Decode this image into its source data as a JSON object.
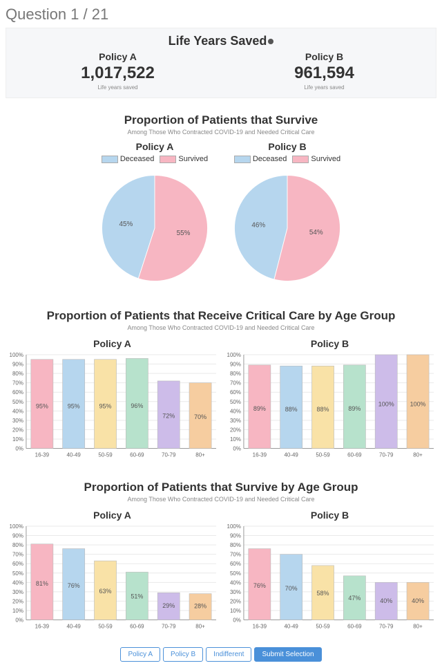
{
  "question_counter": "Question 1 / 21",
  "palette": [
    "#f7b6c2",
    "#b6d6ee",
    "#f9e2a7",
    "#b7e2cc",
    "#cdbce9",
    "#f6cda0"
  ],
  "metrics_panel": {
    "title": "Life Years Saved",
    "policy_a_label": "Policy A",
    "policy_b_label": "Policy B",
    "policy_a_value": "1,017,522",
    "policy_b_value": "961,594",
    "sub": "Life years saved"
  },
  "survival_section": {
    "title": "Proportion of Patients that Survive",
    "sub": "Among Those Who Contracted COVID-19 and Needed Critical Care",
    "policy_a_label": "Policy A",
    "policy_b_label": "Policy B",
    "legend": {
      "deceased": "Deceased",
      "survived": "Survived"
    },
    "policy_a": {
      "deceased_pct": 45,
      "survived_pct": 55
    },
    "policy_b": {
      "deceased_pct": 46,
      "survived_pct": 54
    }
  },
  "critical_care_section": {
    "title": "Proportion of Patients that Receive Critical Care by Age Group",
    "sub": "Among Those Who Contracted COVID-19 and Needed Critical Care",
    "policy_a_label": "Policy A",
    "policy_b_label": "Policy B",
    "categories": [
      "16-39",
      "40-49",
      "50-59",
      "60-69",
      "70-79",
      "80+"
    ],
    "policy_a_values": [
      95,
      95,
      95,
      96,
      72,
      70
    ],
    "policy_b_values": [
      89,
      88,
      88,
      89,
      100,
      100
    ]
  },
  "survive_by_age_section": {
    "title": "Proportion of Patients that Survive by Age Group",
    "sub": "Among Those Who Contracted COVID-19 and Needed Critical Care",
    "policy_a_label": "Policy A",
    "policy_b_label": "Policy B",
    "categories": [
      "16-39",
      "40-49",
      "50-59",
      "60-69",
      "70-79",
      "80+"
    ],
    "policy_a_values": [
      81,
      76,
      63,
      51,
      29,
      28
    ],
    "policy_b_values": [
      76,
      70,
      58,
      47,
      40,
      40
    ]
  },
  "actions": {
    "policy_a": "Policy A",
    "policy_b": "Policy B",
    "indifferent": "Indifferent",
    "submit": "Submit Selection"
  },
  "chart_data": [
    {
      "type": "pie",
      "title": "Proportion of Patients that Survive — Policy A",
      "series": [
        {
          "name": "Deceased",
          "value": 45
        },
        {
          "name": "Survived",
          "value": 55
        }
      ]
    },
    {
      "type": "pie",
      "title": "Proportion of Patients that Survive — Policy B",
      "series": [
        {
          "name": "Deceased",
          "value": 46
        },
        {
          "name": "Survived",
          "value": 54
        }
      ]
    },
    {
      "type": "bar",
      "title": "Proportion of Patients that Receive Critical Care by Age Group — Policy A",
      "categories": [
        "16-39",
        "40-49",
        "50-59",
        "60-69",
        "70-79",
        "80+"
      ],
      "values": [
        95,
        95,
        95,
        96,
        72,
        70
      ],
      "ylim": [
        0,
        100
      ],
      "ylabel": "%"
    },
    {
      "type": "bar",
      "title": "Proportion of Patients that Receive Critical Care by Age Group — Policy B",
      "categories": [
        "16-39",
        "40-49",
        "50-59",
        "60-69",
        "70-79",
        "80+"
      ],
      "values": [
        89,
        88,
        88,
        89,
        100,
        100
      ],
      "ylim": [
        0,
        100
      ],
      "ylabel": "%"
    },
    {
      "type": "bar",
      "title": "Proportion of Patients that Survive by Age Group — Policy A",
      "categories": [
        "16-39",
        "40-49",
        "50-59",
        "60-69",
        "70-79",
        "80+"
      ],
      "values": [
        81,
        76,
        63,
        51,
        29,
        28
      ],
      "ylim": [
        0,
        100
      ],
      "ylabel": "%"
    },
    {
      "type": "bar",
      "title": "Proportion of Patients that Survive by Age Group — Policy B",
      "categories": [
        "16-39",
        "40-49",
        "50-59",
        "60-69",
        "70-79",
        "80+"
      ],
      "values": [
        76,
        70,
        58,
        47,
        40,
        40
      ],
      "ylim": [
        0,
        100
      ],
      "ylabel": "%"
    }
  ]
}
